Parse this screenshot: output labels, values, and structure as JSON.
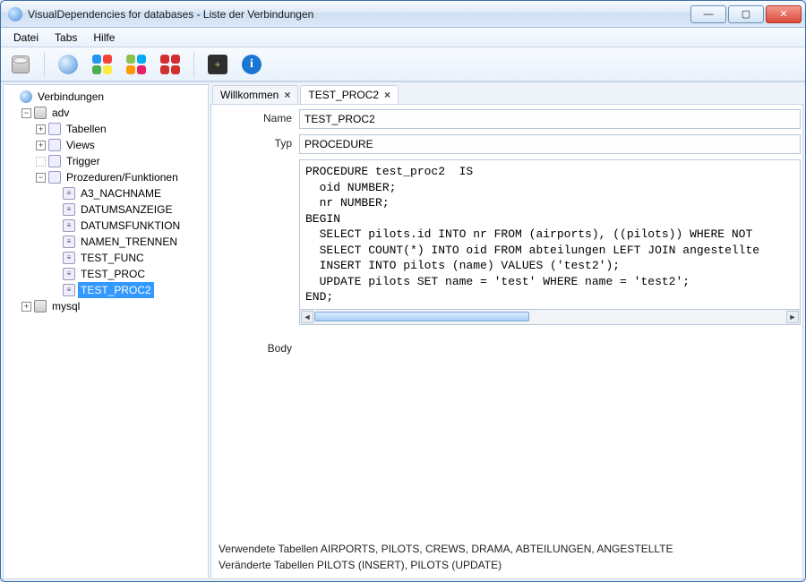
{
  "window": {
    "title": "VisualDependencies for databases - Liste der Verbindungen"
  },
  "menu": {
    "file": "Datei",
    "tabs": "Tabs",
    "help": "Hilfe"
  },
  "tree": {
    "root": "Verbindungen",
    "db1": "adv",
    "db1_children": {
      "tables": "Tabellen",
      "views": "Views",
      "trigger": "Trigger",
      "procs": "Prozeduren/Funktionen",
      "proc_items": {
        "p0": "A3_NACHNAME",
        "p1": "DATUMSANZEIGE",
        "p2": "DATUMSFUNKTION",
        "p3": "NAMEN_TRENNEN",
        "p4": "TEST_FUNC",
        "p5": "TEST_PROC",
        "p6": "TEST_PROC2"
      }
    },
    "db2": "mysql"
  },
  "tabs": {
    "t0": "Willkommen",
    "t1": "TEST_PROC2"
  },
  "form": {
    "name_label": "Name",
    "name_value": "TEST_PROC2",
    "typ_label": "Typ",
    "typ_value": "PROCEDURE",
    "body_label": "Body",
    "body_value": "PROCEDURE test_proc2  IS\n  oid NUMBER;\n  nr NUMBER;\nBEGIN\n  SELECT pilots.id INTO nr FROM (airports), ((pilots)) WHERE NOT\n  SELECT COUNT(*) INTO oid FROM abteilungen LEFT JOIN angestellte\n  INSERT INTO pilots (name) VALUES ('test2');\n  UPDATE pilots SET name = 'test' WHERE name = 'test2';\nEND;"
  },
  "summary": {
    "used_label": "Verwendete Tabellen",
    "used_value": "AIRPORTS, PILOTS, CREWS, DRAMA, ABTEILUNGEN, ANGESTELLTE",
    "changed_label": "Veränderte Tabellen",
    "changed_value": "PILOTS (INSERT), PILOTS (UPDATE)"
  }
}
